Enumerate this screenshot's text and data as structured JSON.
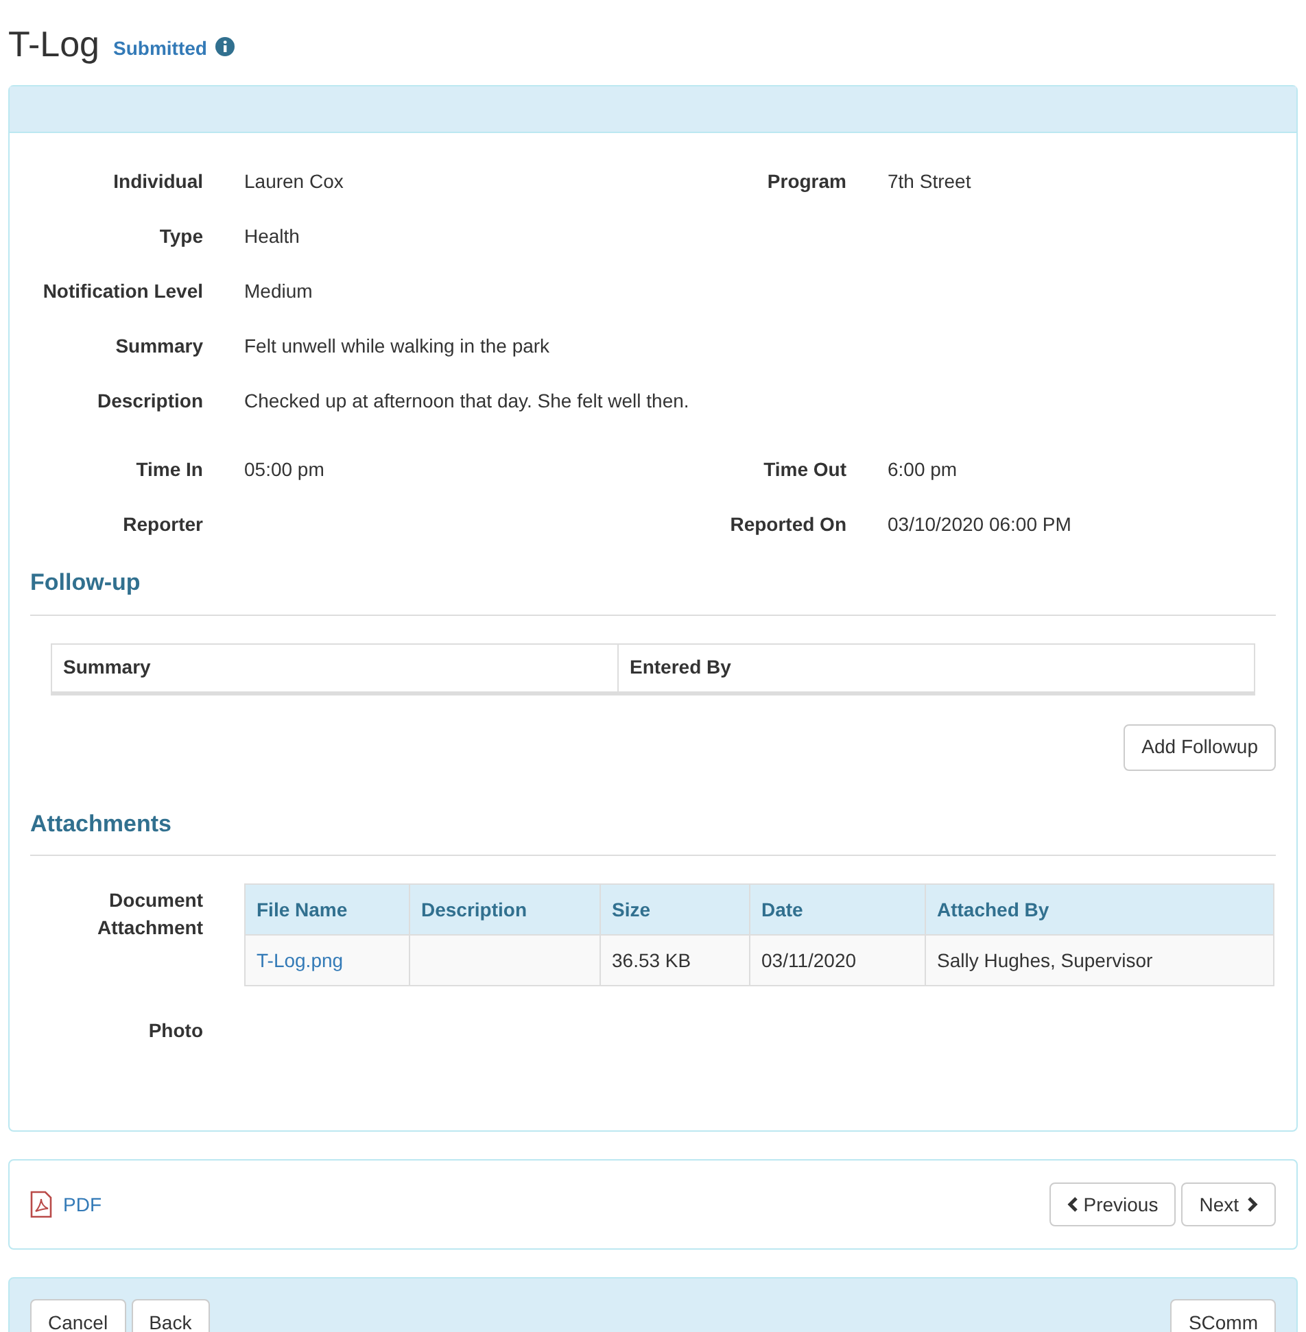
{
  "page": {
    "title": "T-Log",
    "status": "Submitted"
  },
  "details": [
    {
      "left": {
        "label": "Individual",
        "value": "Lauren Cox"
      },
      "right": {
        "label": "Program",
        "value": "7th Street"
      }
    },
    {
      "left": {
        "label": "Type",
        "value": "Health"
      }
    },
    {
      "left": {
        "label": "Notification Level",
        "value": "Medium"
      }
    },
    {
      "left": {
        "label": "Summary",
        "value": "Felt unwell while walking in the park"
      }
    },
    {
      "left": {
        "label": "Description",
        "value": "Checked up at afternoon that day. She felt well then."
      }
    },
    {
      "left": {
        "label": "Time In",
        "value": "05:00 pm"
      },
      "right": {
        "label": "Time Out",
        "value": "6:00 pm"
      }
    },
    {
      "left": {
        "label": "Reporter"
      },
      "right": {
        "label": "Reported On",
        "value": "03/10/2020 06:00 PM"
      }
    }
  ],
  "followup": {
    "heading": "Follow-up",
    "columns": [
      "Summary",
      "Entered By"
    ],
    "add_button": "Add Followup"
  },
  "attachments": {
    "heading": "Attachments",
    "document_label": "Document Attachment",
    "columns": [
      "File Name",
      "Description",
      "Size",
      "Date",
      "Attached By"
    ],
    "rows": [
      {
        "file_name": "T-Log.png",
        "description": "",
        "size": "36.53 KB",
        "date": "03/11/2020",
        "attached_by": "Sally Hughes, Supervisor"
      }
    ],
    "photo_label": "Photo"
  },
  "nav": {
    "pdf": "PDF",
    "previous": "Previous",
    "next": "Next"
  },
  "actions": {
    "left": [
      "Cancel",
      "Back"
    ],
    "right": [
      "SComm"
    ]
  }
}
